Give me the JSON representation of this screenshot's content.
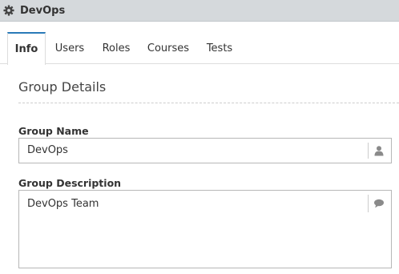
{
  "header": {
    "title": "DevOps",
    "icon": "gear-icon"
  },
  "tabs": [
    {
      "label": "Info",
      "active": true
    },
    {
      "label": "Users",
      "active": false
    },
    {
      "label": "Roles",
      "active": false
    },
    {
      "label": "Courses",
      "active": false
    },
    {
      "label": "Tests",
      "active": false
    }
  ],
  "section": {
    "title": "Group Details"
  },
  "fields": {
    "name": {
      "label": "Group Name",
      "value": "DevOps",
      "icon": "user-icon"
    },
    "description": {
      "label": "Group Description",
      "value": "DevOps Team",
      "icon": "comment-icon"
    }
  },
  "colors": {
    "header_bg": "#d5d9dc",
    "active_tab_accent": "#2a7ab8",
    "icon_gray": "#8a8a8a"
  }
}
